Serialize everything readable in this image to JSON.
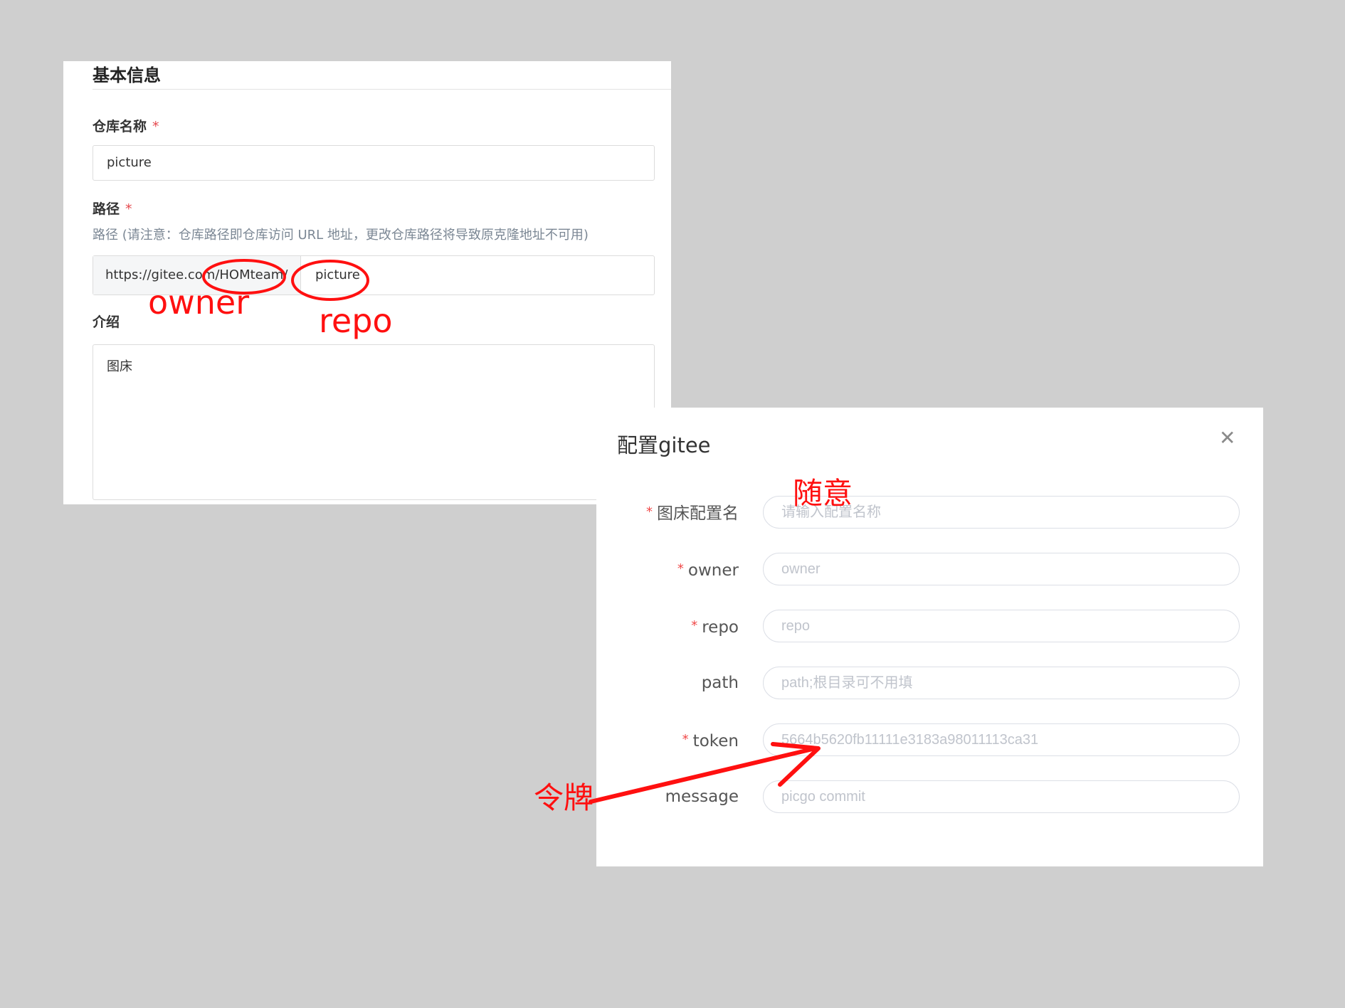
{
  "repo_form": {
    "section_title": "基本信息",
    "name_label": "仓库名称",
    "required_mark": "*",
    "name_value": "picture",
    "path_label": "路径",
    "path_hint": "路径 (请注意：仓库路径即仓库访问 URL 地址，更改仓库路径将导致原克隆地址不可用)",
    "path_prefix": "https://gitee.com/HOMteam/",
    "path_value": "picture",
    "intro_label": "介绍",
    "intro_value": "图床"
  },
  "config_dialog": {
    "title": "配置gitee",
    "close_symbol": "✕",
    "fields": [
      {
        "label": "图床配置名",
        "required": true,
        "placeholder": "请输入配置名称"
      },
      {
        "label": "owner",
        "required": true,
        "placeholder": "owner"
      },
      {
        "label": "repo",
        "required": true,
        "placeholder": "repo"
      },
      {
        "label": "path",
        "required": false,
        "placeholder": "path;根目录可不用填"
      },
      {
        "label": "token",
        "required": true,
        "placeholder": "5664b5620fb11111e3183a98011113ca31"
      },
      {
        "label": "message",
        "required": false,
        "placeholder": "picgo commit"
      }
    ]
  },
  "annotations": {
    "owner": "owner",
    "repo": "repo",
    "config_name": "随意",
    "token": "令牌",
    "color": "#ff1010"
  },
  "colors": {
    "background": "#cfcfcf",
    "required_star": "#f04848",
    "placeholder": "#c0c4cc"
  },
  "icons": [
    "close-icon",
    "arrow-icon"
  ]
}
